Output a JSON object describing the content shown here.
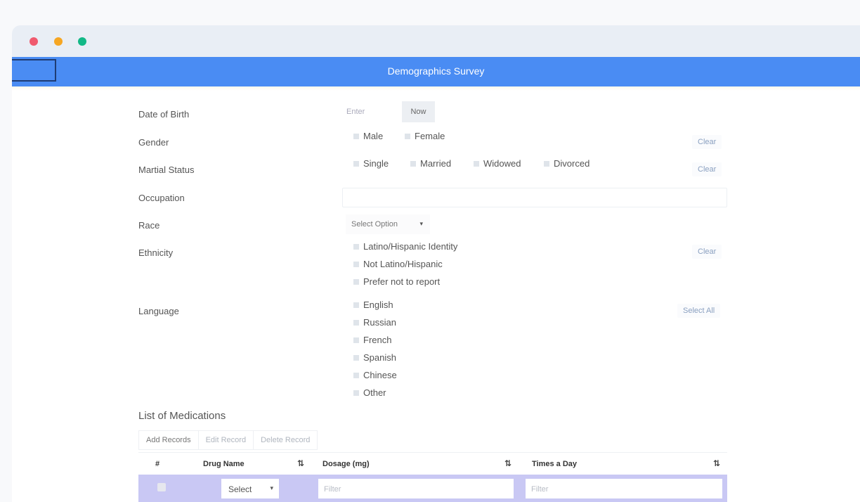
{
  "window": {
    "dots": [
      {
        "name": "close",
        "color": "#f05a6e"
      },
      {
        "name": "minimize",
        "color": "#f6a623"
      },
      {
        "name": "maximize",
        "color": "#12b886"
      }
    ]
  },
  "header": {
    "title": "Demographics Survey",
    "color": "#4a8cf3"
  },
  "form": {
    "dob": {
      "label": "Date of Birth",
      "placeholder": "Enter",
      "now_label": "Now"
    },
    "gender": {
      "label": "Gender",
      "options": [
        "Male",
        "Female"
      ],
      "clear_label": "Clear"
    },
    "marital": {
      "label": "Martial Status",
      "options": [
        "Single",
        "Married",
        "Widowed",
        "Divorced"
      ],
      "clear_label": "Clear"
    },
    "occupation": {
      "label": "Occupation",
      "value": ""
    },
    "race": {
      "label": "Race",
      "selected": "Select Option",
      "caret": "▾"
    },
    "ethnicity": {
      "label": "Ethnicity",
      "options": [
        "Latino/Hispanic Identity",
        "Not Latino/Hispanic",
        "Prefer not to report"
      ],
      "clear_label": "Clear"
    },
    "language": {
      "label": "Language",
      "options": [
        "English",
        "Russian",
        "French",
        "Spanish",
        "Chinese",
        "Other"
      ],
      "select_all_label": "Select All"
    }
  },
  "medications": {
    "title": "List of Medications",
    "buttons": {
      "add": "Add Records",
      "edit": "Edit Record",
      "delete": "Delete Record"
    },
    "columns": [
      "#",
      "Drug Name",
      "Dosage (mg)",
      "Times a Day"
    ],
    "sort_glyph": "⇅",
    "row": {
      "drug_select": "Select",
      "caret": "▾",
      "dosage_placeholder": "Filter",
      "times_placeholder": "Filter"
    },
    "row_highlight_color": "#c9c8f4"
  }
}
